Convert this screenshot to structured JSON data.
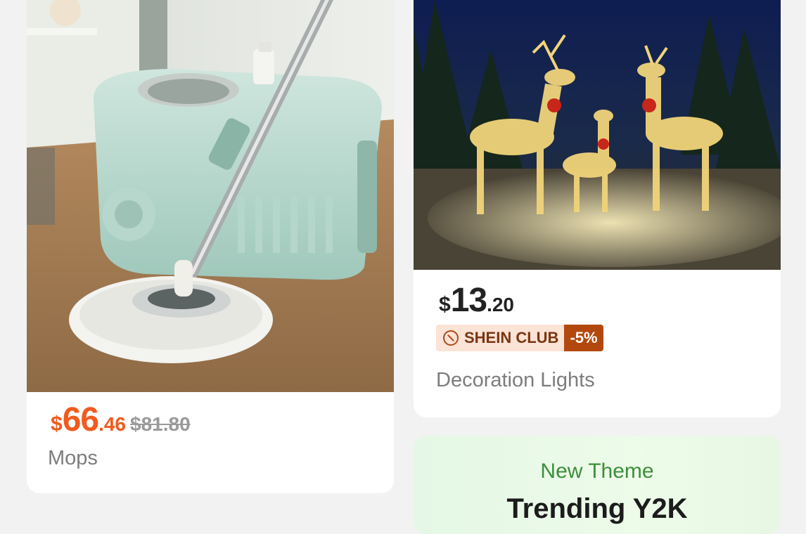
{
  "products": [
    {
      "price_currency": "$",
      "price_main": "66",
      "price_cents": ".46",
      "original_price": "$81.80",
      "title": "Mops"
    },
    {
      "price_currency": "$",
      "price_main": "13",
      "price_cents": ".20",
      "club_label": "SHEIN CLUB",
      "club_discount": "-5%",
      "title": "Decoration Lights"
    }
  ],
  "theme_card": {
    "kicker": "New Theme",
    "title": "Trending Y2K"
  },
  "colors": {
    "sale_price": "#f25a1d",
    "club_bg": "#fbe3d6",
    "club_discount_bg": "#b3480e",
    "theme_green": "#3c8f3a"
  }
}
